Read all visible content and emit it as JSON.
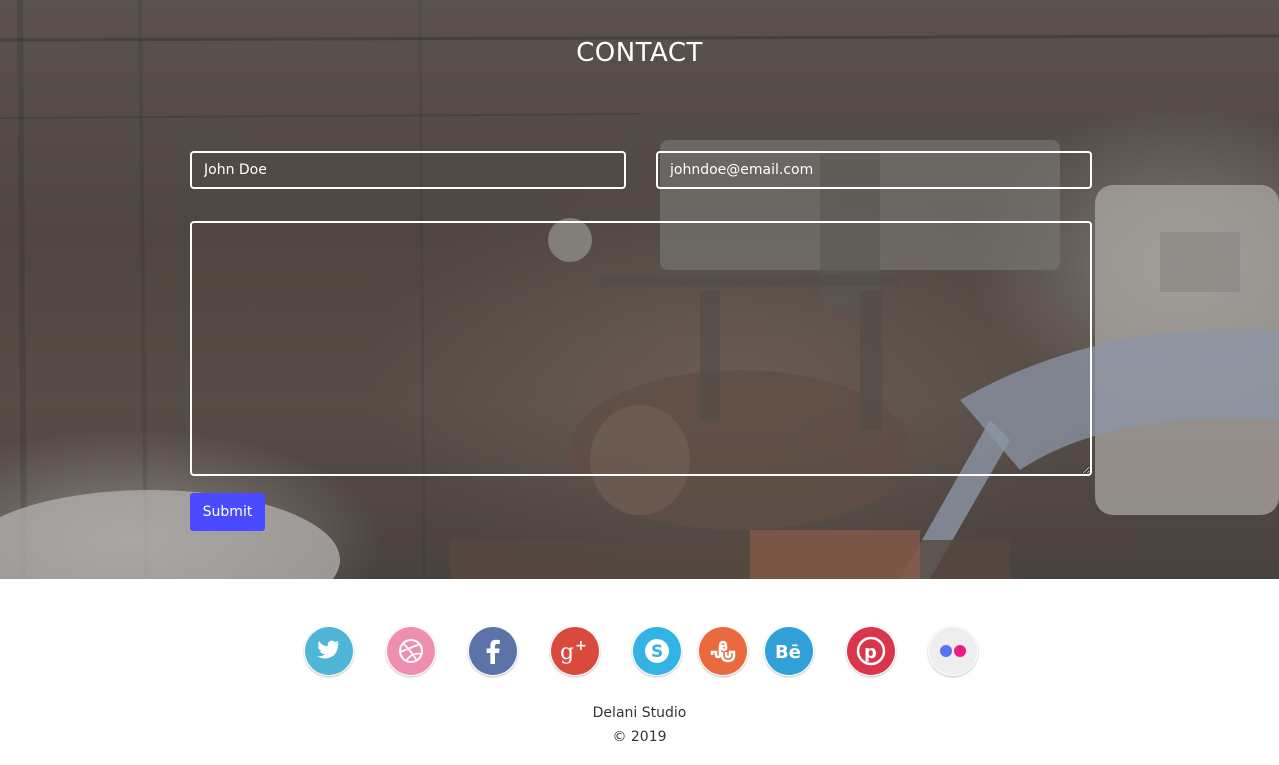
{
  "contact": {
    "title": "CONTACT",
    "name_placeholder": "John Doe",
    "email_placeholder": "johndoe@email.com",
    "message_placeholder": "",
    "submit_label": "Submit"
  },
  "social": [
    {
      "icon": "twitter-icon",
      "color": "#4fb6d8"
    },
    {
      "icon": "dribbble-icon",
      "color": "#ee8fb2"
    },
    {
      "icon": "facebook-icon",
      "color": "#5a73a9"
    },
    {
      "icon": "google-plus-icon",
      "color": "#d94a3d"
    },
    {
      "icon": "skype-icon",
      "color": "#33b2e4"
    },
    {
      "icon": "stumbleupon-icon",
      "color": "#ea6a3d"
    },
    {
      "icon": "behance-icon",
      "color": "#2fa0d8"
    },
    {
      "icon": "pinterest-icon",
      "color": "#d9364d"
    },
    {
      "icon": "flickr-icon",
      "color": "#eeeeee"
    }
  ],
  "footer": {
    "studio": "Delani Studio",
    "copyright": "© 2019"
  },
  "colors": {
    "accent": "#4a4aff",
    "field_border": "#ffffff"
  }
}
